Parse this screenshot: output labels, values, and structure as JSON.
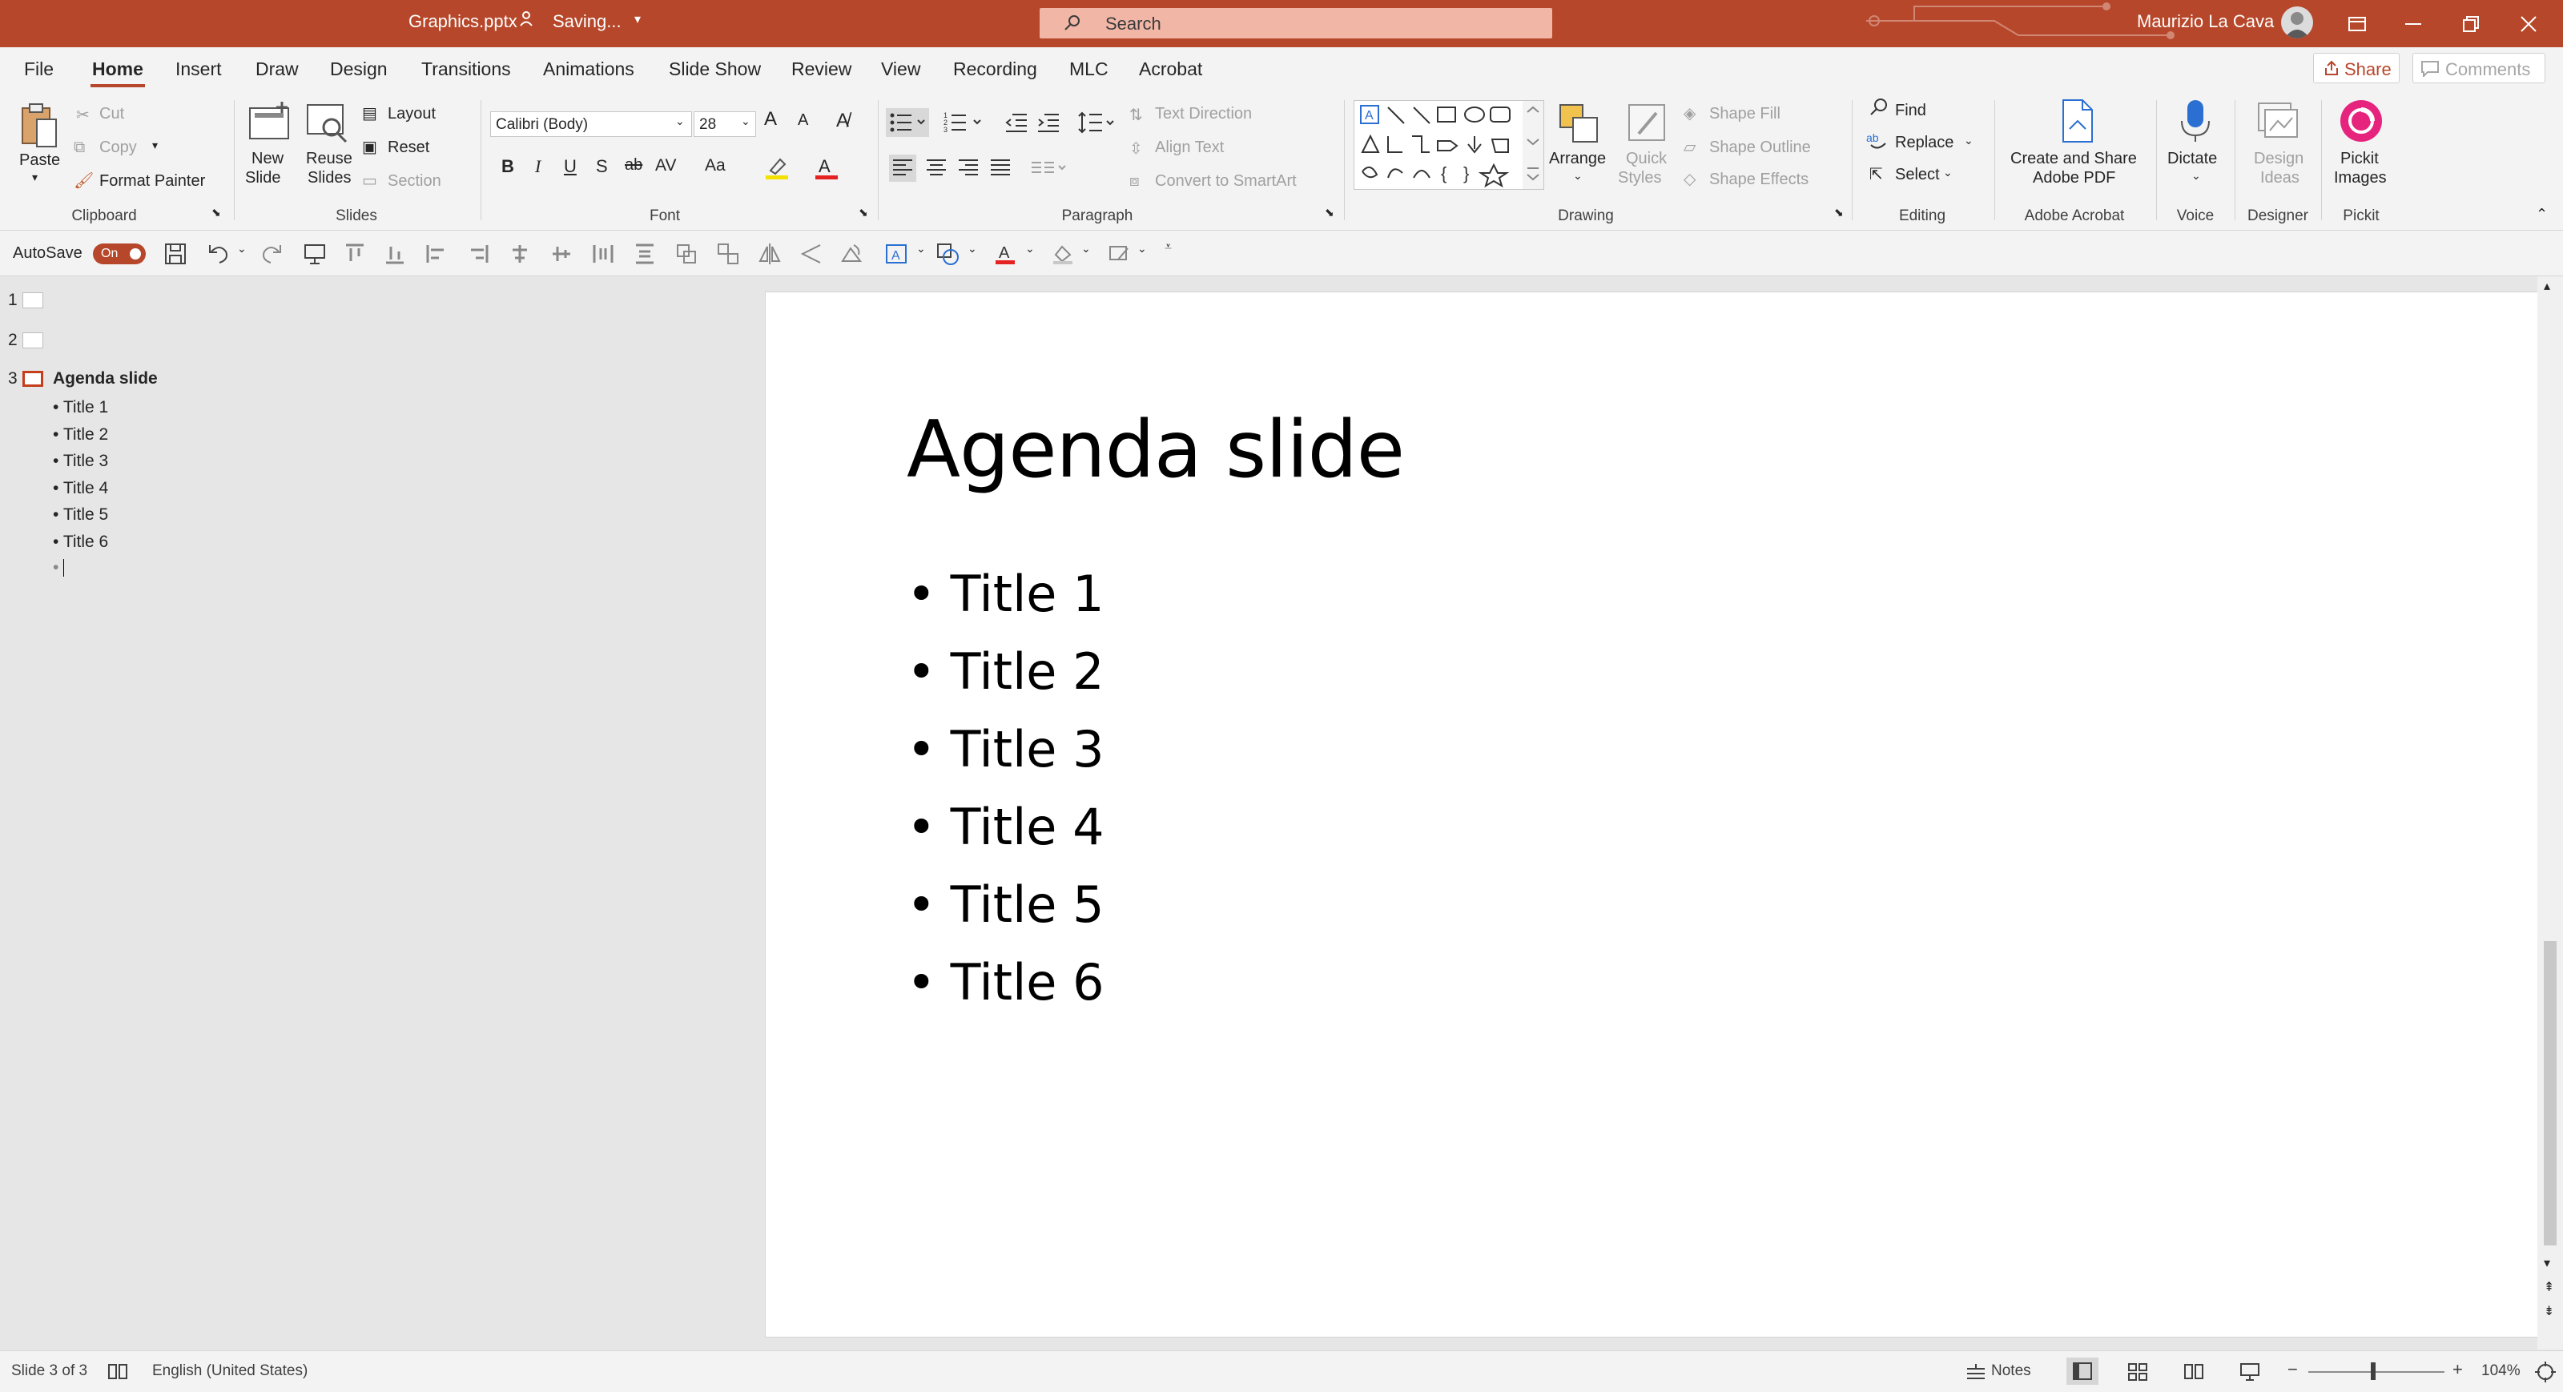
{
  "titlebar": {
    "filename": "Graphics.pptx",
    "status": "Saving...",
    "search_placeholder": "Search",
    "user_name": "Maurizio La Cava"
  },
  "menu": {
    "tabs": [
      "File",
      "Home",
      "Insert",
      "Draw",
      "Design",
      "Transitions",
      "Animations",
      "Slide Show",
      "Review",
      "View",
      "Recording",
      "MLC",
      "Acrobat"
    ],
    "share": "Share",
    "comments": "Comments"
  },
  "ribbon": {
    "clipboard": {
      "label": "Clipboard",
      "paste": "Paste",
      "cut": "Cut",
      "copy": "Copy",
      "format_painter": "Format Painter"
    },
    "slides": {
      "label": "Slides",
      "new_slide_1": "New",
      "new_slide_2": "Slide",
      "reuse_1": "Reuse",
      "reuse_2": "Slides",
      "layout": "Layout",
      "reset": "Reset",
      "section": "Section"
    },
    "font": {
      "label": "Font",
      "font_name": "Calibri (Body)",
      "font_size": "28",
      "bold": "B",
      "italic": "I",
      "underline": "U",
      "shadow": "S",
      "strike": "ab",
      "spacing": "AV",
      "case": "Aa",
      "grow": "A",
      "shrink": "A"
    },
    "paragraph": {
      "label": "Paragraph",
      "text_direction": "Text Direction",
      "align_text": "Align Text",
      "convert_smartart": "Convert to SmartArt"
    },
    "drawing": {
      "label": "Drawing",
      "arrange": "Arrange",
      "quick_1": "Quick",
      "quick_2": "Styles",
      "shape_fill": "Shape Fill",
      "shape_outline": "Shape Outline",
      "shape_effects": "Shape Effects"
    },
    "editing": {
      "label": "Editing",
      "find": "Find",
      "replace": "Replace",
      "select": "Select"
    },
    "acrobat": {
      "label": "Adobe Acrobat",
      "create_1": "Create and Share",
      "create_2": "Adobe PDF"
    },
    "voice": {
      "label": "Voice",
      "dictate": "Dictate"
    },
    "designer": {
      "label": "Designer",
      "ideas_1": "Design",
      "ideas_2": "Ideas"
    },
    "pickit": {
      "label": "Pickit",
      "images_1": "Pickit",
      "images_2": "Images"
    }
  },
  "qat": {
    "autosave": "AutoSave",
    "toggle": "On"
  },
  "outline": {
    "slides": [
      {
        "num": "1"
      },
      {
        "num": "2"
      },
      {
        "num": "3",
        "title": "Agenda slide",
        "bullets": [
          "Title 1",
          "Title 2",
          "Title 3",
          "Title 4",
          "Title 5",
          "Title 6"
        ]
      }
    ]
  },
  "slide": {
    "title": "Agenda slide",
    "bullets": [
      "Title 1",
      "Title 2",
      "Title 3",
      "Title 4",
      "Title 5",
      "Title 6"
    ]
  },
  "statusbar": {
    "slide_info": "Slide 3 of 3",
    "language": "English (United States)",
    "notes": "Notes",
    "zoom": "104%"
  },
  "colors": {
    "accent": "#b7472a",
    "selection": "#c43e1c"
  }
}
